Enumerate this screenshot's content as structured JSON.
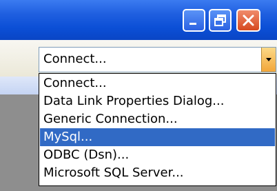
{
  "window": {
    "minimize_icon": "minimize-icon",
    "restore_icon": "restore-icon",
    "close_icon": "close-icon"
  },
  "connect_combo": {
    "value": "Connect...",
    "arrow_icon": "chevron-down-icon"
  },
  "dropdown": {
    "items": [
      {
        "label": "Connect..."
      },
      {
        "label": "Data Link Properties Dialog..."
      },
      {
        "label": "Generic Connection..."
      },
      {
        "label": "MySql..."
      },
      {
        "label": "ODBC (Dsn)..."
      },
      {
        "label": "Microsoft SQL Server..."
      }
    ],
    "selected_index": 3
  },
  "colors": {
    "titlebar": "#0b4fd6",
    "selection": "#316ac5",
    "close_button": "#d6491f"
  }
}
